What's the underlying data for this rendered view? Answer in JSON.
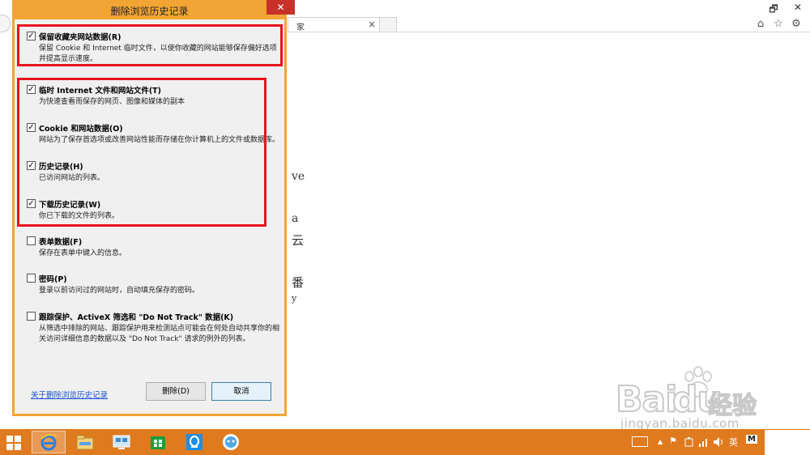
{
  "browser": {
    "tab_title": "家",
    "tab_close": "×",
    "fragments": [
      "ve",
      "a",
      "云",
      "番",
      "y"
    ],
    "window_controls": [
      "🗗",
      "✕"
    ],
    "toolbar_icons": [
      "home-icon",
      "star-icon",
      "gear-icon"
    ],
    "toolbar_glyphs": [
      "⌂",
      "☆",
      "⚙"
    ]
  },
  "watermark": {
    "brand": "Bai",
    "brand_end": "du",
    "brand_cn": "经验",
    "url": "jingyan.baidu.com"
  },
  "dialog": {
    "title": "删除浏览历史记录",
    "close": "✕",
    "options": [
      {
        "label": "保留收藏夹网站数据(R)",
        "desc": "保留 Cookie 和 Internet 临时文件，以使你收藏的网站能够保存偏好选项并提高显示速度。",
        "checked": true
      },
      {
        "label": "临时 Internet 文件和网站文件(T)",
        "desc": "为快速查看而保存的网页、图像和媒体的副本",
        "checked": true
      },
      {
        "label": "Cookie 和网站数据(O)",
        "desc": "网站为了保存首选项或改善网站性能而存储在你计算机上的文件或数据库。",
        "checked": true
      },
      {
        "label": "历史记录(H)",
        "desc": "已访问网站的列表。",
        "checked": true
      },
      {
        "label": "下载历史记录(W)",
        "desc": "你已下载的文件的列表。",
        "checked": true
      },
      {
        "label": "表单数据(F)",
        "desc": "保存在表单中键入的信息。",
        "checked": false
      },
      {
        "label": "密码(P)",
        "desc": "登录以前访问过的网站时，自动填充保存的密码。",
        "checked": false
      },
      {
        "label": "跟踪保护、ActiveX 筛选和 \"Do Not Track\" 数据(K)",
        "desc": "从筛选中排除的网站、跟踪保护用来检测站点可能会在何处自动共享你的相关访问详细信息的数据以及 \"Do Not Track\" 请求的例外的列表。",
        "checked": false
      }
    ],
    "check_mark": "✓",
    "link": "关于删除浏览历史记录",
    "delete_button": "删除(D)",
    "cancel_button": "取消"
  },
  "taskbar": {
    "apps": [
      "ie-icon",
      "file-explorer-icon",
      "remote-desktop-icon",
      "store-icon",
      "qq-icon",
      "chat-icon"
    ],
    "tray": {
      "arrow": "▲",
      "flag": "⚑",
      "ime_lang": "英",
      "ime_mode": "M"
    }
  },
  "colors": {
    "dialog_frame": "#f2a534",
    "highlight": "#e8131f",
    "taskbar": "#e07a1e",
    "close": "#c7312a"
  }
}
